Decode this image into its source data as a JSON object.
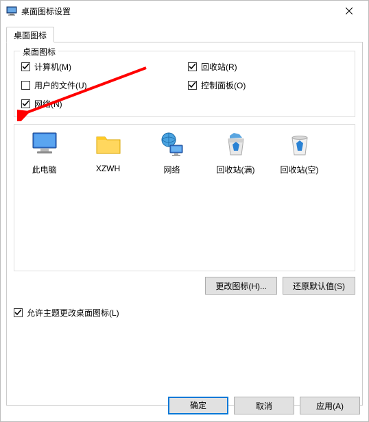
{
  "titlebar": {
    "title": "桌面图标设置"
  },
  "tab": {
    "label": "桌面图标"
  },
  "groupbox": {
    "title": "桌面图标",
    "checkboxes": {
      "computer": {
        "label": "计算机(M)",
        "checked": true
      },
      "recycle": {
        "label": "回收站(R)",
        "checked": true
      },
      "userfiles": {
        "label": "用户的文件(U)",
        "checked": false
      },
      "controlpanel": {
        "label": "控制面板(O)",
        "checked": true
      },
      "network": {
        "label": "网络(N)",
        "checked": true
      }
    }
  },
  "icons": {
    "thispc": "此电脑",
    "xzwh": "XZWH",
    "network": "网络",
    "recycle_full": "回收站(满)",
    "recycle_empty": "回收站(空)"
  },
  "buttons": {
    "change_icon": "更改图标(H)...",
    "restore_default": "还原默认值(S)"
  },
  "theme_check": {
    "label": "允许主题更改桌面图标(L)",
    "checked": true
  },
  "dialog_buttons": {
    "ok": "确定",
    "cancel": "取消",
    "apply": "应用(A)"
  }
}
